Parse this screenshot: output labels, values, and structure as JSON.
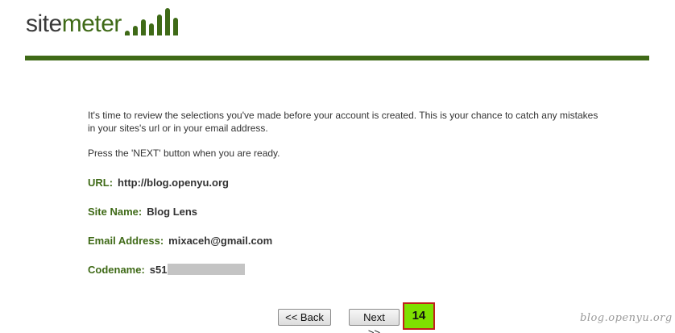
{
  "brand": {
    "name_part1": "site",
    "name_part2": "meter",
    "accent_color": "#3f6a17"
  },
  "review": {
    "intro": "It's time to review the selections you've made before your account is created. This is your chance to catch any mistakes in your sites's url or in your email address.",
    "instruction": "Press the 'NEXT' button when you are ready."
  },
  "fields": {
    "url": {
      "label": "URL:",
      "value": "http://blog.openyu.org"
    },
    "site_name": {
      "label": "Site Name:",
      "value": "Blog Lens"
    },
    "email": {
      "label": "Email Address:",
      "value": "mixaceh@gmail.com"
    },
    "codename": {
      "label": "Codename:",
      "value": "s51"
    }
  },
  "buttons": {
    "back": "<< Back",
    "next": "Next >>"
  },
  "badge": {
    "number": "14",
    "fill_color": "#7fe000",
    "border_color": "#c0201c"
  },
  "watermark": "blog.openyu.org"
}
